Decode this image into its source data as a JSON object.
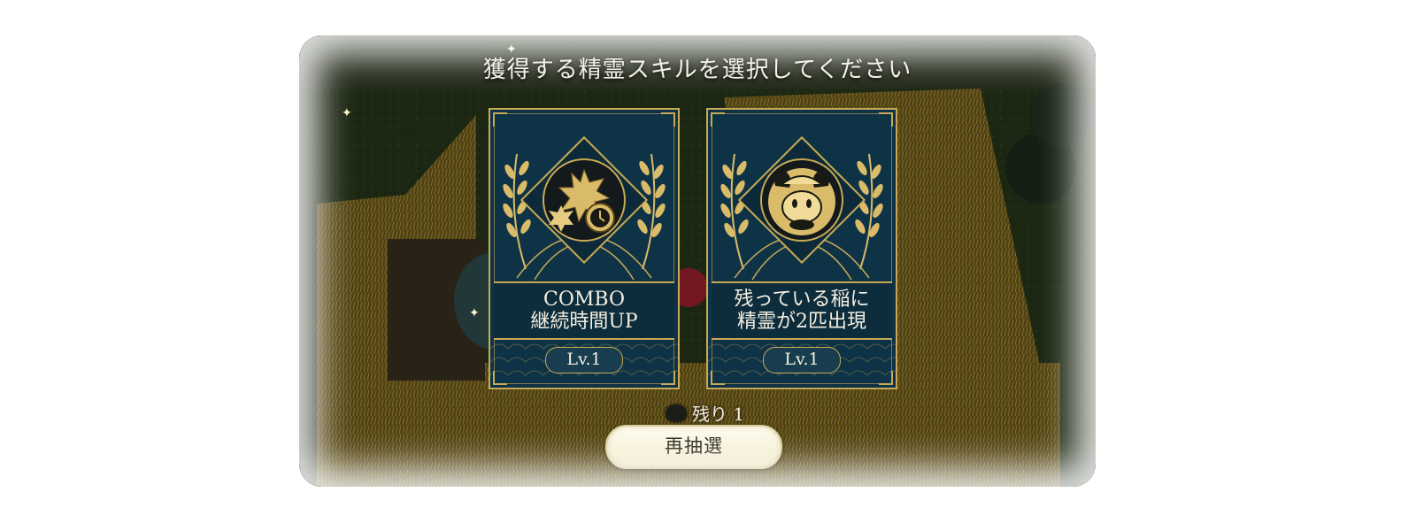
{
  "prompt": "獲得する精霊スキルを選択してください",
  "cards": [
    {
      "name_line1": "COMBO",
      "name_line2": "継続時間UP",
      "level": "Lv.1",
      "icon": "combo-timer-icon"
    },
    {
      "name_line1": "残っている稲に",
      "name_line2": "精霊が2匹出現",
      "level": "Lv.1",
      "icon": "rice-spirit-icon"
    }
  ],
  "remaining": {
    "label": "残り 1",
    "icon": "spirit-bag-icon"
  },
  "reroll_button": {
    "label": "再抽選"
  },
  "colors": {
    "card_bg": "#0f3346",
    "gold": "#c8a955",
    "text": "#f4efe0",
    "button_bg": "#fffdf1"
  }
}
